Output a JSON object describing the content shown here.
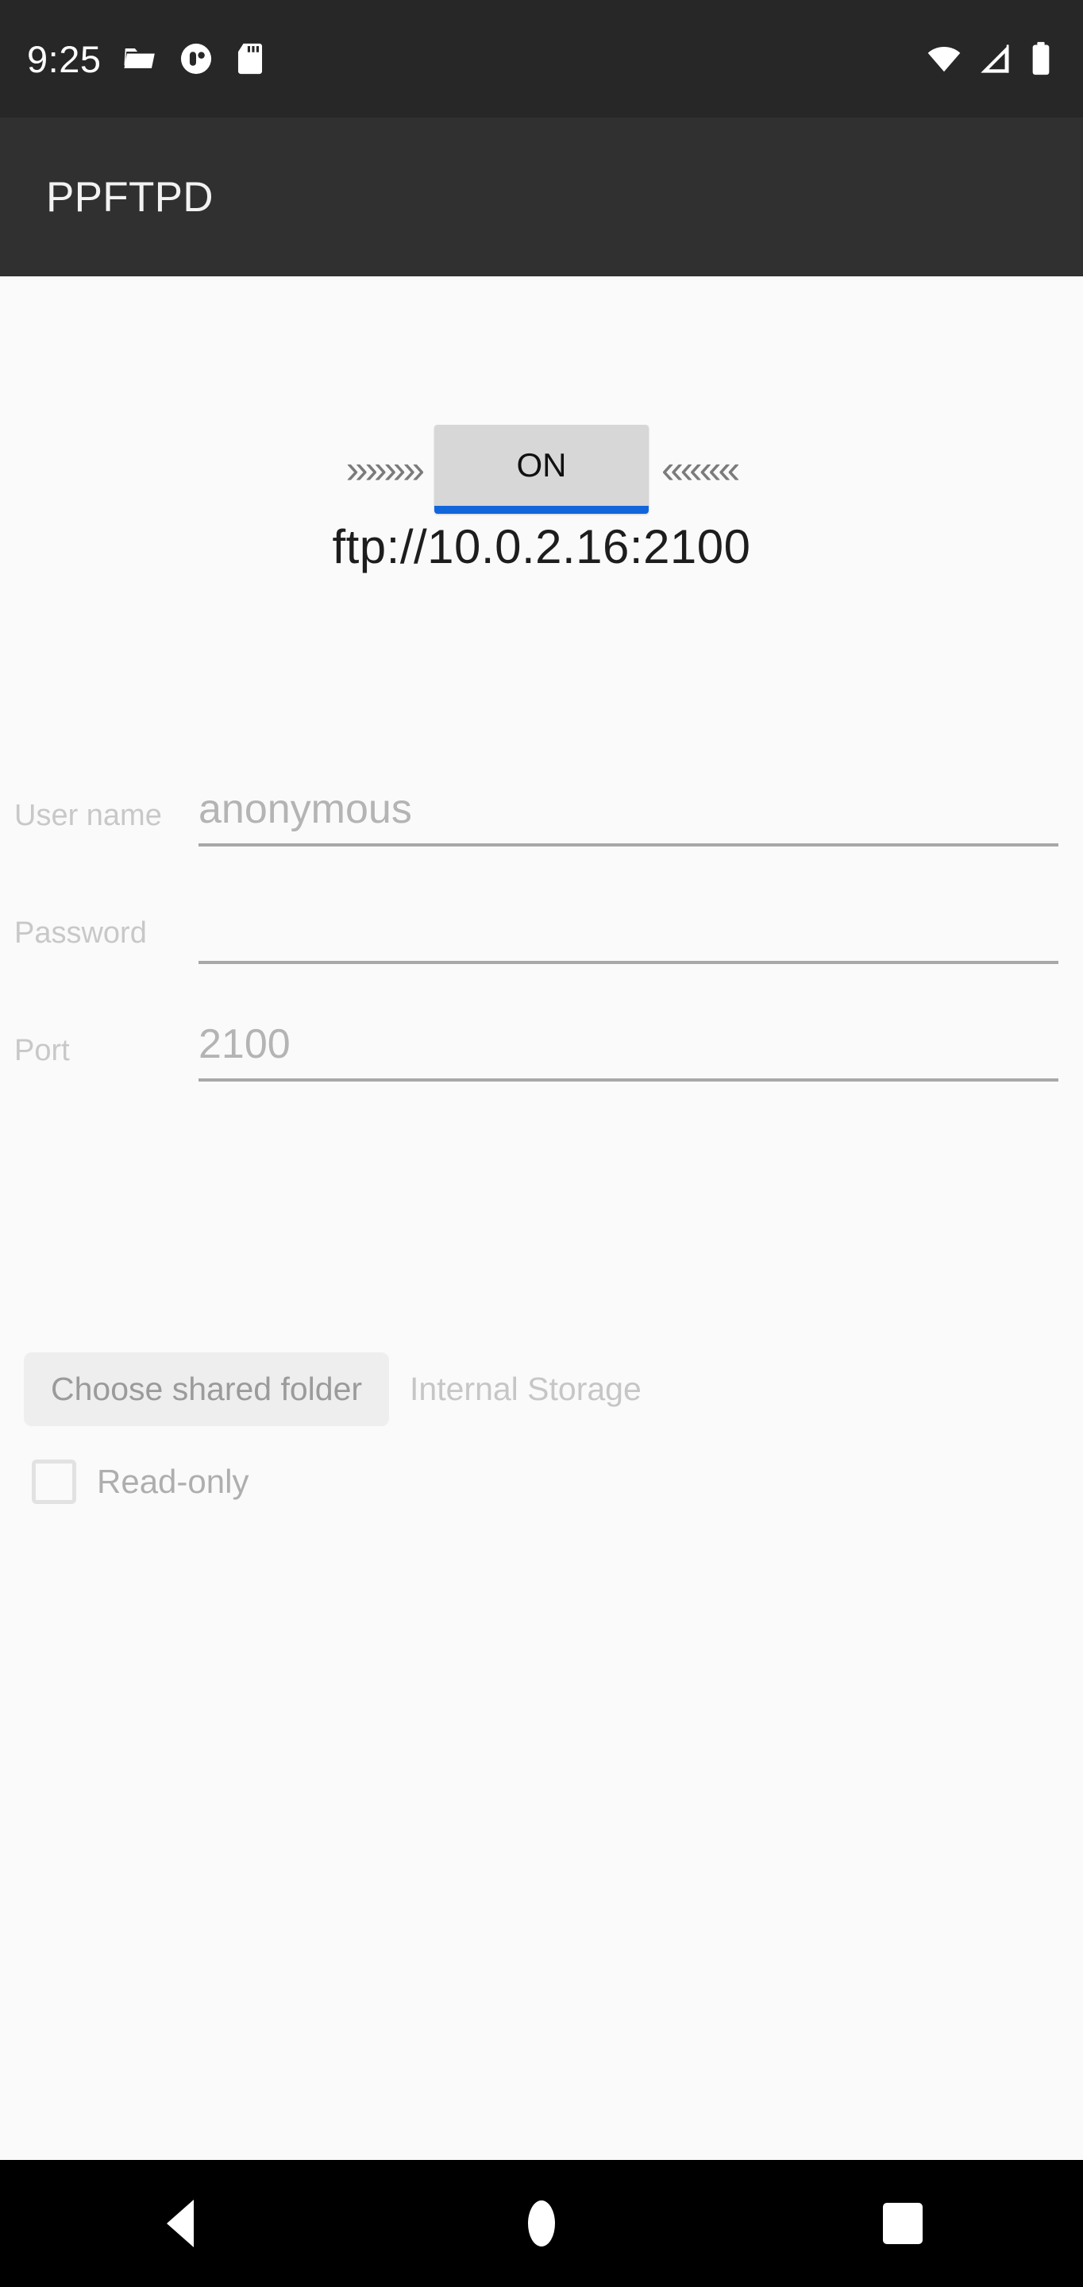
{
  "status_bar": {
    "time": "9:25",
    "notification_icons": [
      "folder-icon",
      "app-circle-icon",
      "sd-card-icon"
    ],
    "system_icons": [
      "wifi-icon",
      "cellular-signal-icon",
      "battery-icon"
    ],
    "background_color": "#272727"
  },
  "action_bar": {
    "title": "PPFTPD",
    "background_color": "#303030",
    "text_color": "#f2f2f2"
  },
  "server": {
    "toggle_label": "ON",
    "toggle_accent_color": "#1266dc",
    "arrows_left": "»»»»",
    "arrows_right": "««««",
    "url": "ftp://10.0.2.16:2100"
  },
  "form": {
    "fields": [
      {
        "label": "User name",
        "value": "",
        "placeholder": "anonymous"
      },
      {
        "label": "Password",
        "value": "",
        "placeholder": ""
      },
      {
        "label": "Port",
        "value": "",
        "placeholder": "2100"
      }
    ]
  },
  "share": {
    "choose_folder_label": "Choose shared folder",
    "storage_label": "Internal Storage",
    "readonly_label": "Read-only",
    "readonly_checked": false
  },
  "nav_bar": {
    "buttons": [
      "back-button",
      "home-button",
      "recents-button"
    ],
    "background_color": "#000000"
  }
}
